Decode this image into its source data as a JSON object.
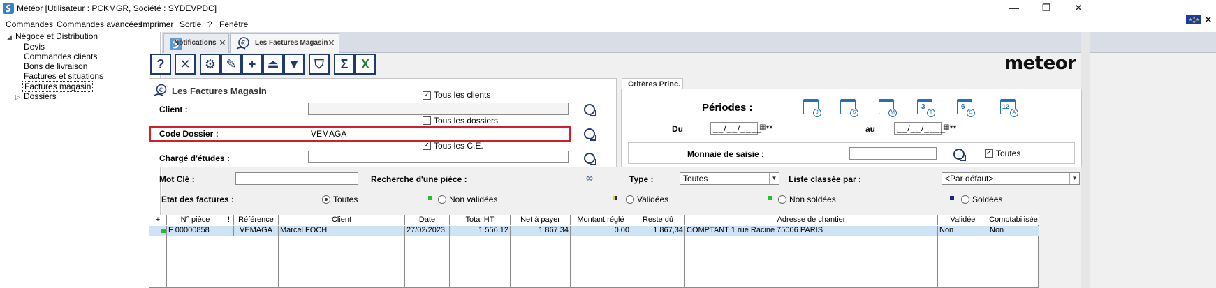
{
  "window": {
    "title": "Météor [Utilisateur : PCKMGR, Société : SYDEVPDC]",
    "minimize": "—",
    "restore": "❐",
    "close": "✕"
  },
  "menu": [
    "Commandes",
    "Commandes avancées",
    "Imprimer",
    "Sortie",
    "?",
    "Fenêtre"
  ],
  "tree": {
    "root": "Négoce et Distribution",
    "items": [
      "Devis",
      "Commandes clients",
      "Bons de livraison",
      "Factures et situations",
      "Factures magasin"
    ],
    "selected_index": 4,
    "folder": "Dossiers"
  },
  "tabs": [
    {
      "label": "Notifications",
      "close": "✕"
    },
    {
      "label": "Les Factures Magasin",
      "close": "✕"
    }
  ],
  "toolbar_icons": [
    "help-icon",
    "cancel-icon",
    "settings-icon",
    "edit-icon",
    "add-icon",
    "eject-icon",
    "down-icon",
    "filter-icon",
    "sum-icon",
    "excel-icon"
  ],
  "toolbar_glyphs": [
    "?",
    "✕",
    "⚙",
    "✎",
    "+",
    "⏏",
    "▼",
    "⛉",
    "Σ",
    "X"
  ],
  "logo": "meteor",
  "main_panel": {
    "title": "Les Factures Magasin",
    "client_label": "Client :",
    "client_value": "",
    "all_clients_label": "Tous les clients",
    "all_clients_checked": true,
    "all_dossiers_label": "Tous les dossiers",
    "all_dossiers_checked": false,
    "code_dossier_label": "Code Dossier :",
    "code_dossier_value": "VEMAGA",
    "all_ce_label": "Tous les C.E.",
    "all_ce_checked": true,
    "charge_label": "Chargé d'études :",
    "charge_value": ""
  },
  "criteria": {
    "tab_label": "Critères Princ.",
    "periods_label": "Périodes :",
    "period_icons": [
      "J",
      "S",
      "M",
      "T",
      "S",
      "A"
    ],
    "period_numbers": [
      "",
      "",
      "",
      "3",
      "6",
      "12"
    ],
    "du_label": "Du",
    "du_value": "__/__/____",
    "au_label": "au",
    "au_value": "__/__/____",
    "monnaie_label": "Monnaie de saisie :",
    "monnaie_value": "",
    "toutes_label": "Toutes",
    "toutes_checked": true
  },
  "search": {
    "mot_cle_label": "Mot Clé :",
    "mot_cle_value": "",
    "recherche_label": "Recherche d'une pièce :",
    "type_label": "Type :",
    "type_value": "Toutes",
    "liste_label": "Liste classée par :",
    "liste_value": "<Par défaut>"
  },
  "etat": {
    "label": "Etat des factures :",
    "options": [
      {
        "label": "Toutes",
        "checked": true,
        "color": ""
      },
      {
        "label": "Non validées",
        "checked": false,
        "color": "#22c32a"
      },
      {
        "label": "Validées",
        "checked": false,
        "color": "#e8d000"
      },
      {
        "label": "Non soldées",
        "checked": false,
        "color": "#22c32a"
      },
      {
        "label": "Soldées",
        "checked": false,
        "color": "#1a237e"
      }
    ]
  },
  "grid": {
    "columns": [
      "+",
      "N° pièce",
      "!",
      "Référence",
      "Client",
      "Date",
      "Total HT",
      "Net à payer",
      "Montant réglé",
      "Reste dû",
      "Adresse de chantier",
      "Validée",
      "Comptabilisée"
    ],
    "rows": [
      [
        "",
        "F 00000858",
        "",
        "VEMAGA",
        "Marcel FOCH",
        "27/02/2023",
        "1 556,12",
        "1 867,34",
        "0,00",
        "1 867,34",
        "COMPTANT 1 rue Racine  75006 PARIS",
        "Non",
        "Non"
      ]
    ],
    "row_status_color": "#22c32a"
  }
}
